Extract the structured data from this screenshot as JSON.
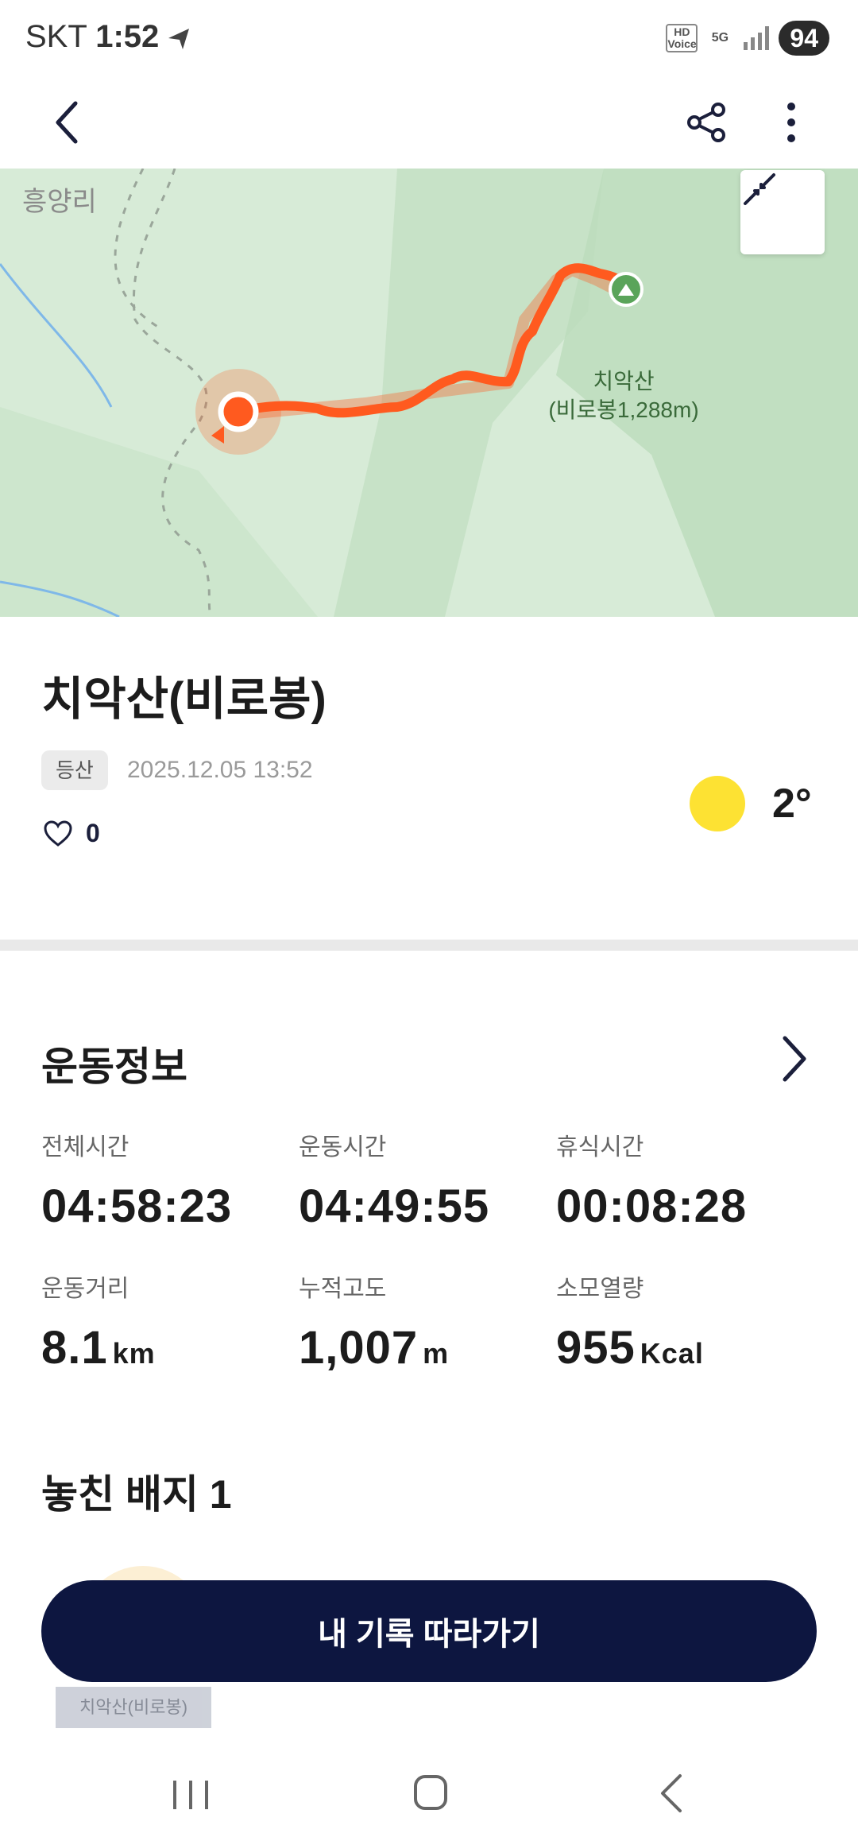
{
  "status_bar": {
    "carrier": "SKT",
    "time": "1:52",
    "hd_voice": "HD Voice",
    "network": "5G",
    "battery": "94"
  },
  "map": {
    "place_label": "흥양리",
    "peak_label_line1": "치악산",
    "peak_label_line2": "(비로봉1,288m)",
    "track_color": "#ff5a1f"
  },
  "activity": {
    "title": "치악산(비로봉)",
    "category": "등산",
    "datetime": "2025.12.05 13:52",
    "likes": "0",
    "temperature": "2°",
    "weather_icon": "sun-icon"
  },
  "exercise_info": {
    "section_title": "운동정보",
    "stats": [
      {
        "label": "전체시간",
        "value": "04:58:23",
        "unit": ""
      },
      {
        "label": "운동시간",
        "value": "04:49:55",
        "unit": ""
      },
      {
        "label": "휴식시간",
        "value": "00:08:28",
        "unit": ""
      },
      {
        "label": "운동거리",
        "value": "8.1",
        "unit": "km"
      },
      {
        "label": "누적고도",
        "value": "1,007",
        "unit": "m"
      },
      {
        "label": "소모열량",
        "value": "955",
        "unit": "Kcal"
      }
    ]
  },
  "badges": {
    "title": "놓친 배지 1",
    "badge_name": "치악산(비로봉)"
  },
  "actions": {
    "follow_label": "내 기록 따라가기"
  },
  "colors": {
    "primary_dark": "#0d1640",
    "accent_orange": "#ff5a1f",
    "sun": "#fde233"
  }
}
